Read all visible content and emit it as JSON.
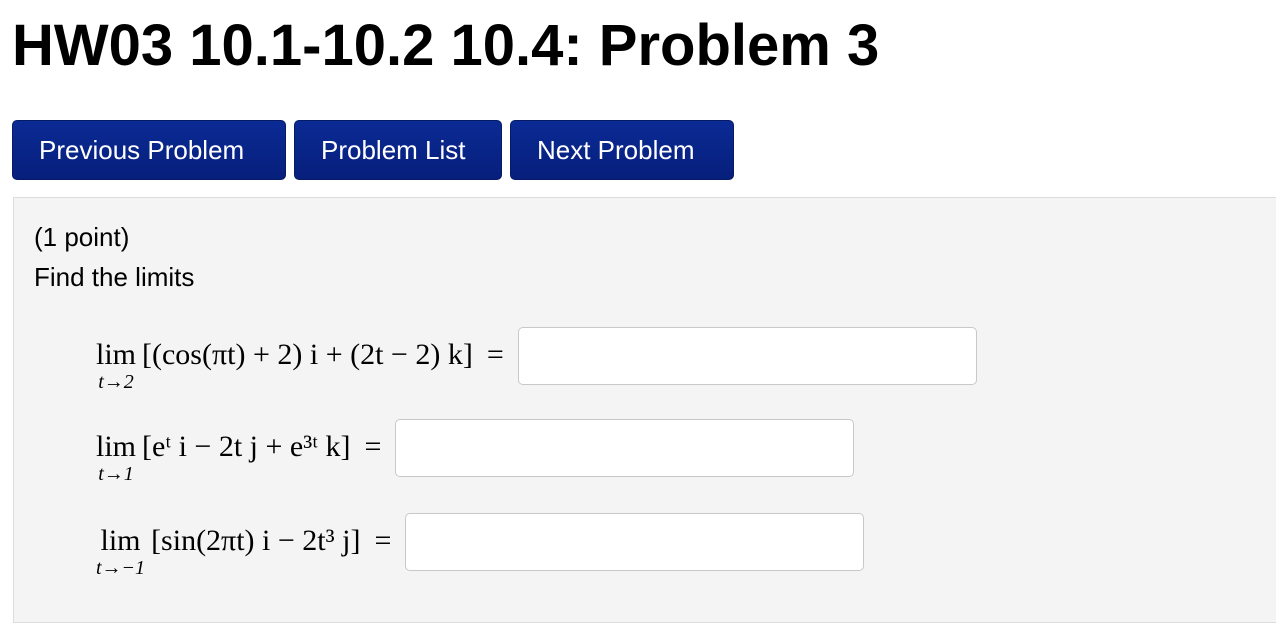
{
  "page_title": "HW03 10.1-10.2 10.4: Problem 3",
  "nav": {
    "previous_label": "Previous Problem",
    "list_label": "Problem List",
    "next_label": "Next Problem"
  },
  "problem": {
    "points": "(1 point)",
    "instructions": "Find the limits",
    "limits": [
      {
        "lim": "lim",
        "sub": "t→2",
        "expr": "[(cos(πt) + 2) i + (2t − 2) k]",
        "equals": "=",
        "answer": ""
      },
      {
        "lim": "lim",
        "sub": "t→1",
        "expr": "[eᵗ i − 2t j + e³ᵗ k]",
        "equals": "=",
        "answer": ""
      },
      {
        "lim": "lim",
        "sub": "t→−1",
        "expr": "[sin(2πt) i − 2t³ j]",
        "equals": "=",
        "answer": ""
      }
    ]
  },
  "colors": {
    "button_bg": "#0a2a94",
    "panel_bg": "#f4f4f4"
  }
}
